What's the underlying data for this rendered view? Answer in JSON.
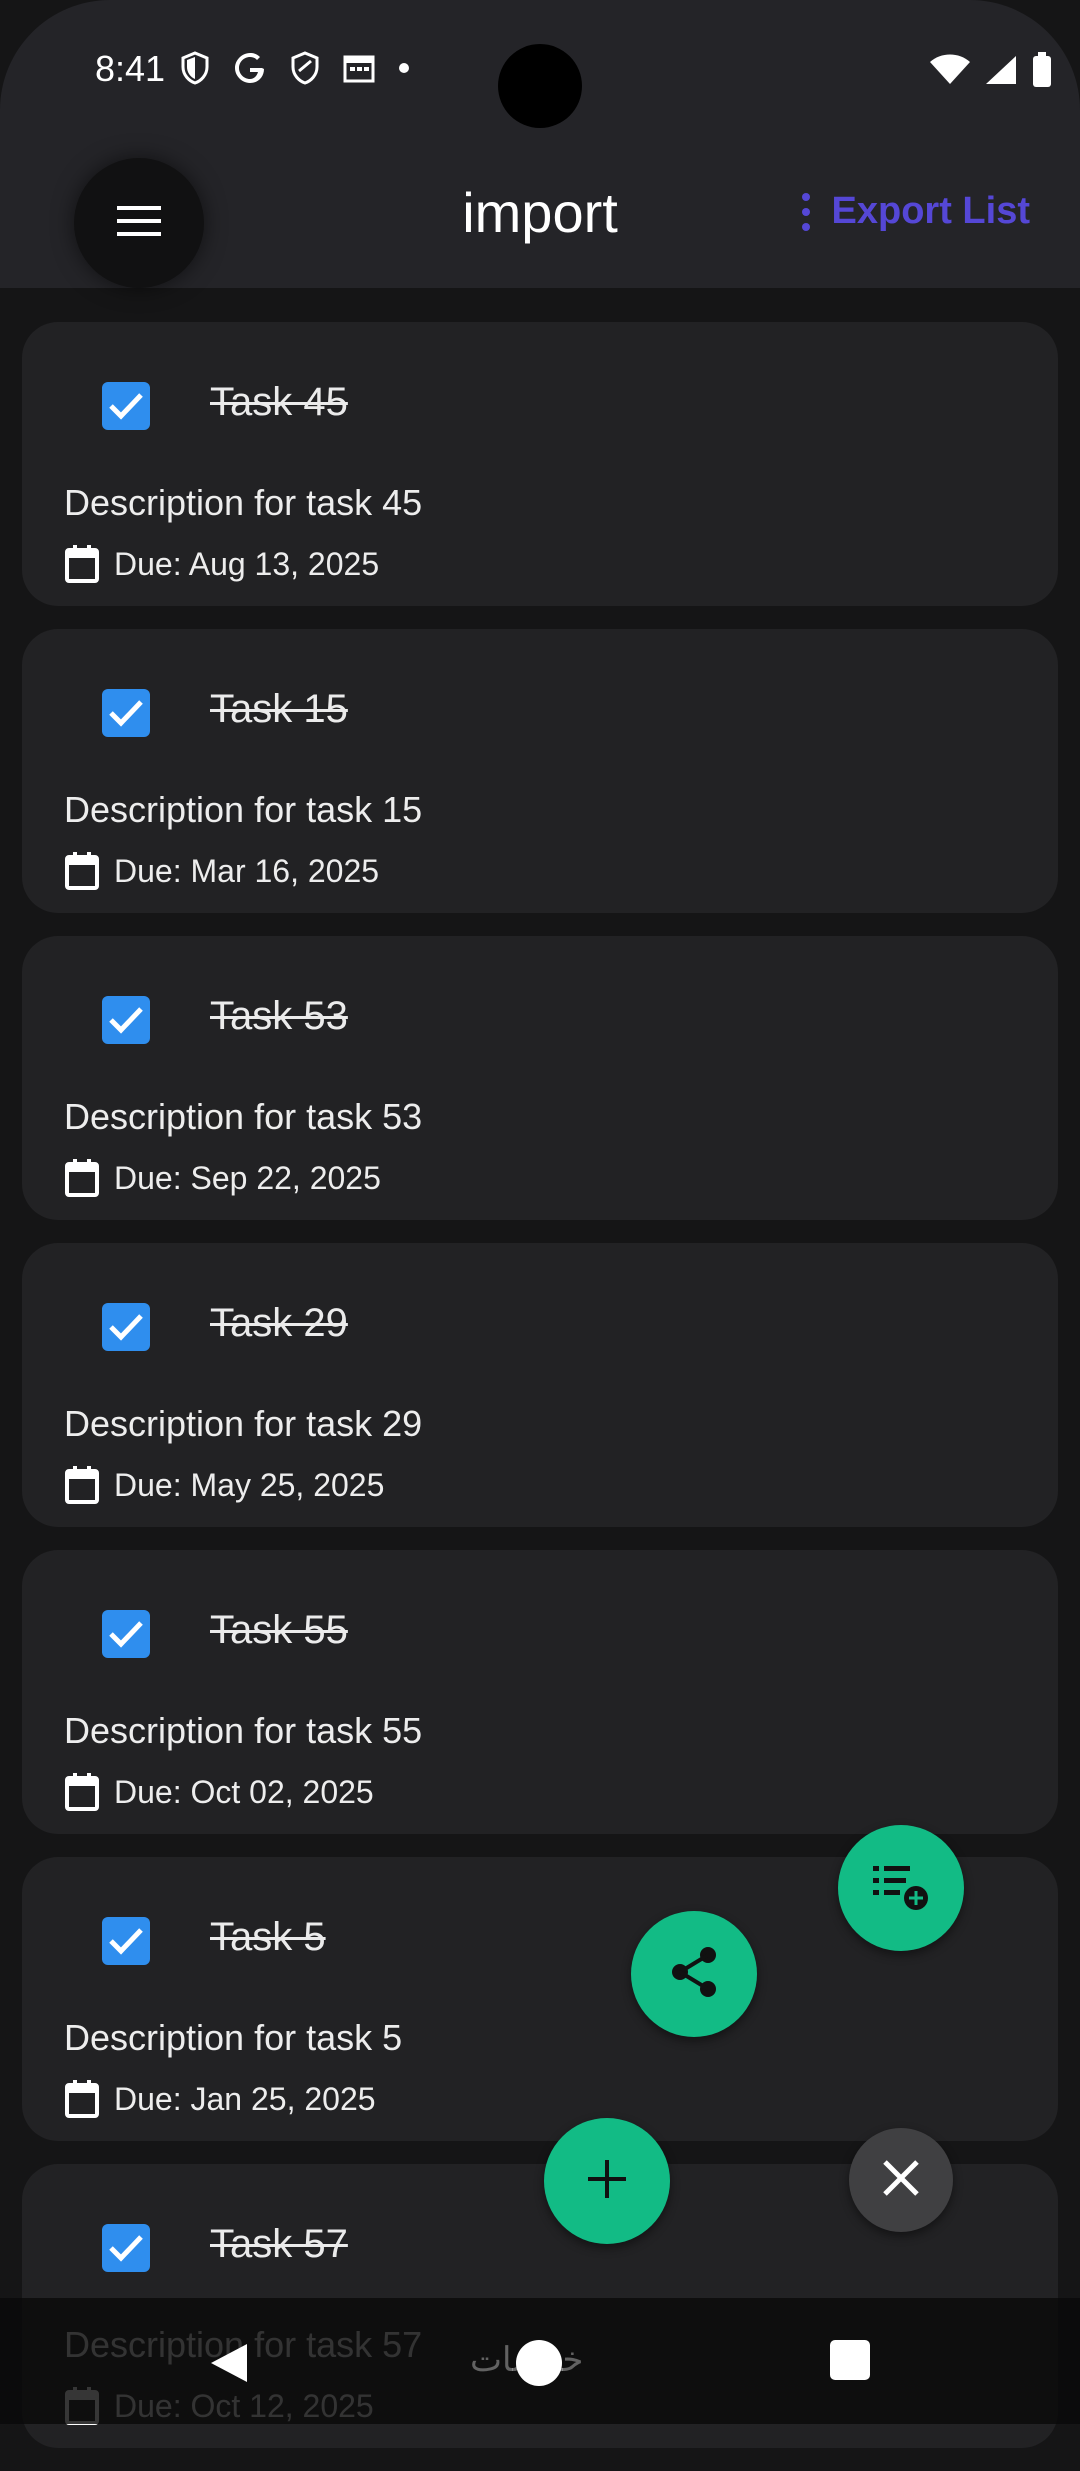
{
  "status_bar": {
    "time": "8:41"
  },
  "app_bar": {
    "title": "import",
    "export_label": "Export List"
  },
  "tasks": [
    {
      "title": "Task 45",
      "description": "Description for task 45",
      "due": "Due: Aug 13, 2025",
      "completed": true
    },
    {
      "title": "Task 15",
      "description": "Description for task 15",
      "due": "Due: Mar 16, 2025",
      "completed": true
    },
    {
      "title": "Task 53",
      "description": "Description for task 53",
      "due": "Due: Sep 22, 2025",
      "completed": true
    },
    {
      "title": "Task 29",
      "description": "Description for task 29",
      "due": "Due: May 25, 2025",
      "completed": true
    },
    {
      "title": "Task 55",
      "description": "Description for task 55",
      "due": "Due: Oct 02, 2025",
      "completed": true
    },
    {
      "title": "Task 5",
      "description": "Description for task 5",
      "due": "Due: Jan 25, 2025",
      "completed": true
    },
    {
      "title": "Task 57",
      "description": "Description for task 57",
      "due": "Due: Oct 12, 2025",
      "completed": true
    }
  ],
  "fabs": {
    "add_list_icon": "playlist-add-icon",
    "share_icon": "share-icon",
    "add_icon": "plus-icon",
    "close_icon": "close-icon"
  },
  "watermark": "خمسات",
  "colors": {
    "accent_green": "#12bb85",
    "checkbox_blue": "#2f8eee",
    "export_purple": "#5547d6",
    "card_bg": "#222224",
    "page_bg": "#151516"
  }
}
